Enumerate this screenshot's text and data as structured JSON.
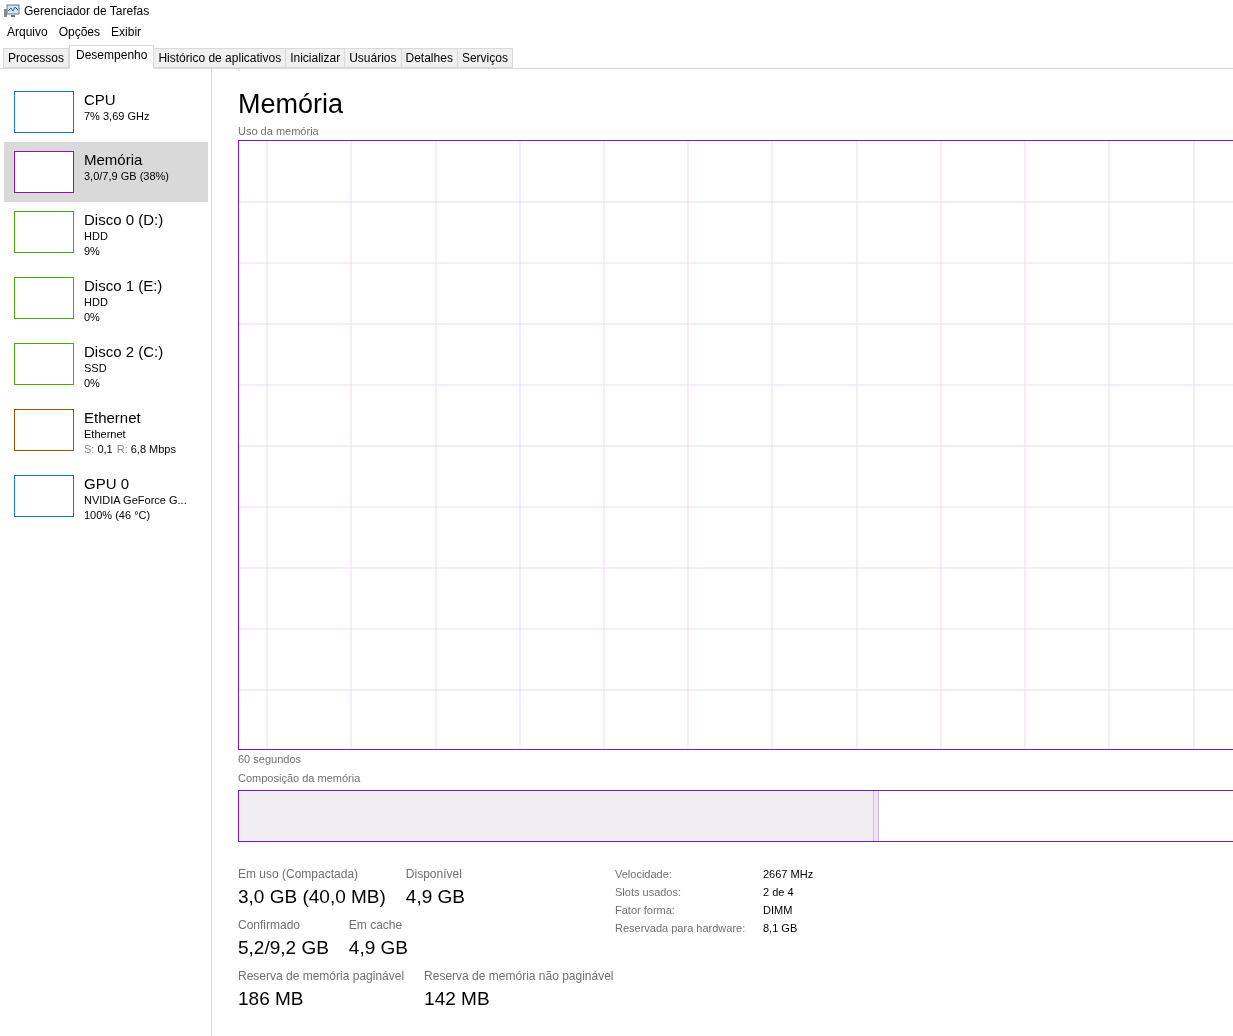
{
  "window": {
    "title": "Gerenciador de Tarefas"
  },
  "menu": [
    "Arquivo",
    "Opções",
    "Exibir"
  ],
  "tabs": [
    {
      "label": "Processos",
      "selected": false
    },
    {
      "label": "Desempenho",
      "selected": true
    },
    {
      "label": "Histórico de aplicativos",
      "selected": false
    },
    {
      "label": "Inicializar",
      "selected": false
    },
    {
      "label": "Usuários",
      "selected": false
    },
    {
      "label": "Detalhes",
      "selected": false
    },
    {
      "label": "Serviços",
      "selected": false
    }
  ],
  "sidebar": {
    "items": [
      {
        "name": "CPU",
        "lines": [
          "7% 3,69 GHz"
        ],
        "color": "#1179c0",
        "selected": false
      },
      {
        "name": "Memória",
        "lines": [
          "3,0/7,9 GB (38%)"
        ],
        "color": "#8b12ae",
        "selected": true
      },
      {
        "name": "Disco 0 (D:)",
        "lines": [
          "HDD",
          "9%"
        ],
        "color": "#4da60c",
        "selected": false
      },
      {
        "name": "Disco 1 (E:)",
        "lines": [
          "HDD",
          "0%"
        ],
        "color": "#4da60c",
        "selected": false
      },
      {
        "name": "Disco 2 (C:)",
        "lines": [
          "SSD",
          "0%"
        ],
        "color": "#4da60c",
        "selected": false
      },
      {
        "name": "Ethernet",
        "lines": [
          "Ethernet"
        ],
        "rates": [
          {
            "label": "S:",
            "value": "0,1"
          },
          {
            "label": "R:",
            "value": "6,8 Mbps"
          }
        ],
        "color": "#a74f01",
        "selected": false
      },
      {
        "name": "GPU 0",
        "lines": [
          "NVIDIA GeForce G...",
          "100%  (46 °C)"
        ],
        "color": "#1179c0",
        "selected": false
      }
    ]
  },
  "main": {
    "title": "Memória",
    "graph_label": "Uso da memória",
    "time_label": "60 segundos",
    "composition_label": "Composição da memória",
    "composition": {
      "level": 0.63
    },
    "stats": [
      [
        {
          "label": "Em uso (Compactada)",
          "value": "3,0 GB (40,0 MB)"
        },
        {
          "label": "Disponível",
          "value": "4,9 GB"
        }
      ],
      [
        {
          "label": "Confirmado",
          "value": "5,2/9,2 GB"
        },
        {
          "label": "Em cache",
          "value": "4,9 GB"
        }
      ],
      [
        {
          "label": "Reserva de memória paginável",
          "value": "186 MB"
        },
        {
          "label": "Reserva de memória não paginável",
          "value": "142 MB"
        }
      ]
    ],
    "details": [
      {
        "label": "Velocidade:",
        "value": "2667 MHz"
      },
      {
        "label": "Slots usados:",
        "value": "2 de 4"
      },
      {
        "label": "Fator forma:",
        "value": "DIMM"
      },
      {
        "label": "Reservada para hardware:",
        "value": "8,1 GB"
      }
    ]
  }
}
